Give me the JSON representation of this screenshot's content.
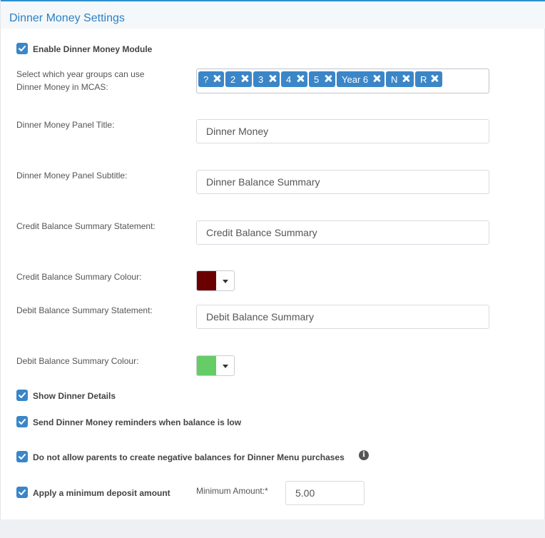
{
  "panel": {
    "title": "Dinner Money Settings"
  },
  "enable_module": {
    "label": "Enable Dinner Money Module",
    "checked": true
  },
  "year_groups": {
    "label_line1": "Select which year groups can use",
    "label_line2": "Dinner Money in MCAS:",
    "tags": [
      "?",
      "2",
      "3",
      "4",
      "5",
      "Year 6",
      "N",
      "R"
    ]
  },
  "panel_title_field": {
    "label": "Dinner Money Panel Title:",
    "value": "Dinner Money"
  },
  "panel_subtitle_field": {
    "label": "Dinner Money Panel Subtitle:",
    "value": "Dinner Balance Summary"
  },
  "credit_statement": {
    "label": "Credit Balance Summary Statement:",
    "value": "Credit Balance Summary"
  },
  "credit_colour": {
    "label": "Credit Balance Summary Colour:",
    "color": "#6b0000"
  },
  "debit_statement": {
    "label": "Debit Balance Summary Statement:",
    "value": "Debit Balance Summary"
  },
  "debit_colour": {
    "label": "Debit Balance Summary Colour:",
    "color": "#66cc66"
  },
  "show_details": {
    "label": "Show Dinner Details",
    "checked": true
  },
  "send_reminders": {
    "label": "Send Dinner Money reminders when balance is low",
    "checked": true
  },
  "no_negative": {
    "label": "Do not allow parents to create negative balances for Dinner Menu purchases",
    "checked": true,
    "icon": "info-icon"
  },
  "min_deposit": {
    "label": "Apply a minimum deposit amount",
    "checked": true,
    "amount_label": "Minimum Amount:*",
    "amount_value": "5.00"
  },
  "colors": {
    "accent": "#3b86c8",
    "header_title": "#2d7fc1",
    "header_border": "#2e8fd1"
  }
}
